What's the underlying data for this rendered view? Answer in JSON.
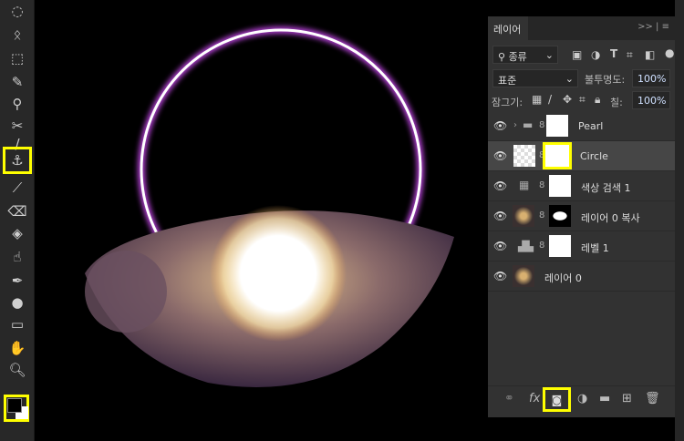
{
  "panel": {
    "tab": "레이어",
    "menu": ">> | ≡",
    "filter": {
      "label": "종류",
      "icon": "search-icon"
    },
    "blend_mode": "표준",
    "opacity_label": "불투명도:",
    "opacity": "100%",
    "lock_label": "잠그기:",
    "fill_label": "칠:",
    "fill": "100%",
    "layers": [
      {
        "name": "Pearl",
        "type": "group",
        "visible": true
      },
      {
        "name": "Circle",
        "type": "smart-object",
        "visible": true,
        "selected": true
      },
      {
        "name": "색상 검색 1",
        "type": "adjustment-color-lookup",
        "visible": true
      },
      {
        "name": "레이어 0 복사",
        "type": "pixel-with-mask",
        "visible": true
      },
      {
        "name": "레벨 1",
        "type": "adjustment-levels",
        "visible": true
      },
      {
        "name": "레이어 0",
        "type": "pixel",
        "visible": true
      }
    ]
  },
  "highlight_color": "#ffff00"
}
